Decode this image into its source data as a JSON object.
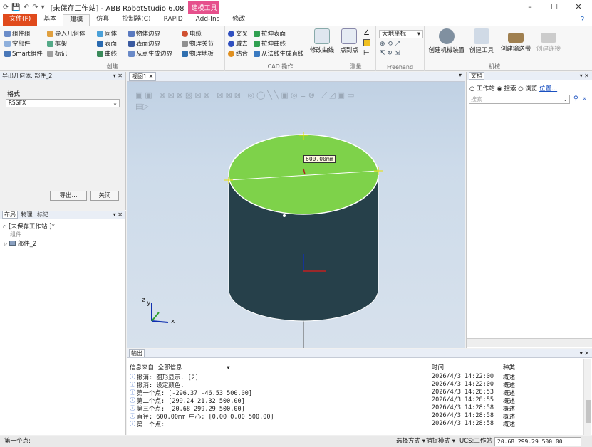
{
  "title": {
    "app_title": "[未保存工作站] - ABB RobotStudio 6.08",
    "context_tab": "建模工具",
    "min": "–",
    "max": "☐",
    "close": "✕"
  },
  "tabs": {
    "file": "文件(F)",
    "basic": "基本",
    "modeling": "建模",
    "simulation": "仿真",
    "controller": "控制器(C)",
    "rapid": "RAPID",
    "addins": "Add-Ins",
    "modify": "修改"
  },
  "ribbon": {
    "create": {
      "label": "创建",
      "component_group": "组件组",
      "empty_part": "空部件",
      "smart_component": "Smart组件",
      "import_geometry": "导入几何体",
      "frame": "框架",
      "tag": "标记",
      "solid": "固体",
      "surface": "表面",
      "curve": "曲线",
      "body_boundary": "物体边界",
      "surface_boundary": "表面边界",
      "boundary_from_point": "从点生成边界",
      "cable": "电缆",
      "physics_joint": "物理关节",
      "physics_floor": "物理地板"
    },
    "cad": {
      "label": "CAD 操作",
      "intersect": "交叉",
      "subtract": "减去",
      "union": "结合",
      "extrude_surface": "拉伸表面",
      "extrude_curve": "拉伸曲线",
      "normal_line": "从法线生成直线",
      "modify_curve": "修改曲线"
    },
    "measure": {
      "label": "测量",
      "point_to_point": "点到点"
    },
    "freehand": {
      "label": "Freehand",
      "coord": "大地坐标"
    },
    "mechanism": {
      "label": "机械",
      "create_mechanism": "创建机械装置",
      "create_tool": "创建工具",
      "create_conveyor": "创建输送带",
      "create_connection": "创建连接"
    }
  },
  "left_top": {
    "header": "导出几何体: 部件_2",
    "format_label": "格式",
    "format_value": "RSGFX",
    "export_button": "导出...",
    "close_button": "关闭"
  },
  "left_bottom": {
    "tabs": [
      "布局",
      "物理",
      "标记"
    ],
    "station": "[未保存工作站 ]*",
    "components": "组件",
    "part": "部件_2"
  },
  "viewport": {
    "tab": "视图1",
    "dimension": "600.00mm",
    "axis_y": "y",
    "axis_z": "z",
    "axis_x": "x"
  },
  "right": {
    "header": "文档",
    "radio_station": "工作站",
    "radio_search": "搜索",
    "radio_browse": "浏览",
    "location_link": "位置...",
    "search_placeholder": "搜索"
  },
  "output": {
    "header": "输出",
    "source_label": "信息来自: 全部信息",
    "col_time": "时间",
    "col_kind": "种类",
    "rows": [
      {
        "msg": "撤消: 图形显示. [2]",
        "time": "2026/4/3 14:22:00",
        "kind": "概述"
      },
      {
        "msg": "撤消: 设定颜色.",
        "time": "2026/4/3 14:22:00",
        "kind": "概述"
      },
      {
        "msg": "第一个点:  [-296.37 -46.53 500.00]",
        "time": "2026/4/3 14:28:53",
        "kind": "概述"
      },
      {
        "msg": "第二个点:  [299.24 21.32 500.00]",
        "time": "2026/4/3 14:28:55",
        "kind": "概述"
      },
      {
        "msg": "第三个点:  [20.68 299.29 500.00]",
        "time": "2026/4/3 14:28:58",
        "kind": "概述"
      },
      {
        "msg": "直径: 600.00mm  中心:  [0.00 0.00 500.00]",
        "time": "2026/4/3 14:28:58",
        "kind": "概述"
      },
      {
        "msg": "第一个点:",
        "time": "2026/4/3 14:28:58",
        "kind": "概述"
      }
    ]
  },
  "status": {
    "left": "第一个点:",
    "select_mode": "选择方式",
    "snap_mode": "捕捉模式",
    "ucs": "UCS:工作站",
    "coords": "20.68  299.29  500.00"
  },
  "colors": {
    "file_tab": "#e04a1c",
    "context_tab": "#e6508c",
    "cylinder_top": "#7ed24a",
    "cylinder_body": "#25404a"
  }
}
